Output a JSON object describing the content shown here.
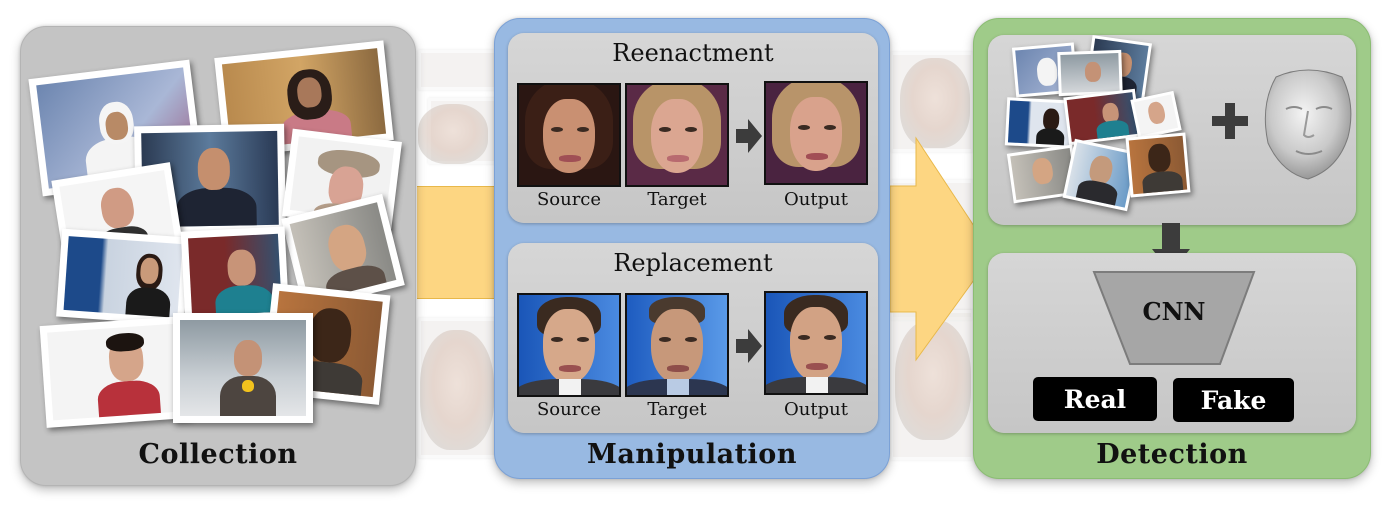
{
  "diagram": {
    "stages": [
      {
        "id": "collection",
        "title": "Collection",
        "color": "#c4c4c4",
        "photos": [
          {
            "description": "man in white keffiyeh, news studio"
          },
          {
            "description": "woman anchor, city background"
          },
          {
            "description": "male anchor in suit, studio"
          },
          {
            "description": "older woman in hat"
          },
          {
            "description": "smiling woman, white background"
          },
          {
            "description": "man with stubble"
          },
          {
            "description": "female anchor, blue studio"
          },
          {
            "description": "female anchor, teal top"
          },
          {
            "description": "man in interview"
          },
          {
            "description": "young man, white background"
          },
          {
            "description": "female reporter with microphone"
          }
        ]
      },
      {
        "id": "manipulation",
        "title": "Manipulation",
        "color": "#98b9e2",
        "methods": [
          {
            "title": "Reenactment",
            "labels": [
              "Source",
              "Target",
              "Output"
            ]
          },
          {
            "title": "Replacement",
            "labels": [
              "Source",
              "Target",
              "Output"
            ]
          }
        ]
      },
      {
        "id": "detection",
        "title": "Detection",
        "color": "#9fcb89",
        "inputs": [
          "face-image-collage",
          "3d-face-model"
        ],
        "plus_symbol": "+",
        "network_label": "CNN",
        "outputs": [
          "Real",
          "Fake"
        ]
      }
    ],
    "arrow_color": "#fdd682"
  }
}
